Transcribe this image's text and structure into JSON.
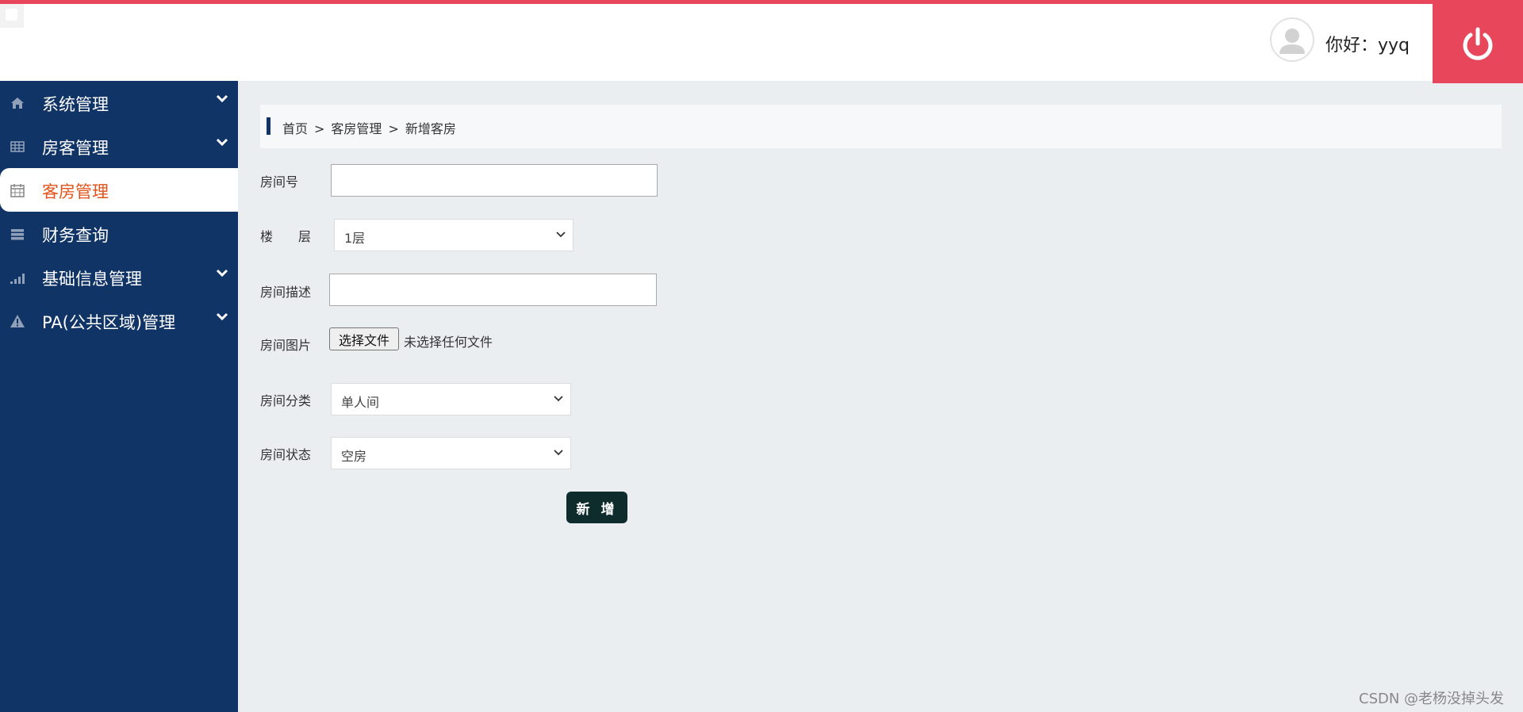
{
  "header": {
    "greeting": "你好：yyq",
    "colors": {
      "accent": "#e8475b",
      "sidebar": "#113466",
      "active_text": "#e2531a",
      "submit": "#0f2c2c"
    }
  },
  "sidebar": {
    "items": [
      {
        "label": "系统管理",
        "icon": "home-icon",
        "expandable": true
      },
      {
        "label": "房客管理",
        "icon": "table-icon",
        "expandable": true
      },
      {
        "label": "客房管理",
        "icon": "calendar-icon",
        "expandable": false,
        "active": true
      },
      {
        "label": "财务查询",
        "icon": "server-icon",
        "expandable": false
      },
      {
        "label": "基础信息管理",
        "icon": "signal-icon",
        "expandable": true
      },
      {
        "label": "PA(公共区域)管理",
        "icon": "warning-icon",
        "expandable": true
      }
    ]
  },
  "breadcrumb": {
    "home": "首页",
    "parent": "客房管理",
    "current": "新增客房",
    "separator": ">"
  },
  "form": {
    "room_number": {
      "label": "房间号",
      "value": ""
    },
    "floor": {
      "label": "楼　　层",
      "selected": "1层"
    },
    "description": {
      "label": "房间描述",
      "value": ""
    },
    "image": {
      "label": "房间图片",
      "button": "选择文件",
      "status": "未选择任何文件"
    },
    "category": {
      "label": "房间分类",
      "selected": "单人间"
    },
    "status": {
      "label": "房间状态",
      "selected": "空房"
    },
    "submit": "新 增"
  },
  "watermark": "CSDN @老杨没掉头发"
}
